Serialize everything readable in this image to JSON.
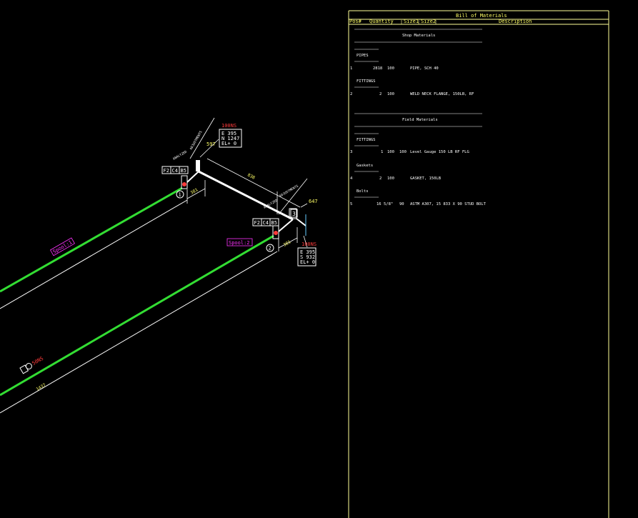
{
  "colors": {
    "background": "#000000",
    "pipe": "#33dd33",
    "line": "#ffffff",
    "frame": "#ffff99",
    "red_label": "#ff3b3b",
    "magenta_label": "#ff33ff",
    "dimension": "#ffff66"
  },
  "iso": {
    "spool1_label": "Spool:1",
    "spool2_label": "Spool:2",
    "node1": "1",
    "node2": "2",
    "node3": "3",
    "flange_tags_top": [
      "F2",
      "C4",
      "B5"
    ],
    "flange_tags_mid": [
      "F2",
      "C4",
      "B5"
    ],
    "top_100ns": "100NS",
    "mid_100ns": "100NS",
    "bottom_50ns": "50NS",
    "coord_top": [
      "E 395",
      "N 1247",
      "EL+ 0"
    ],
    "coord_mid": [
      "E 395",
      "S 932",
      "EL+ 0"
    ],
    "dim_597": "597",
    "dim_647": "647",
    "dim_838": "838",
    "dim_381a": "381",
    "dim_381b": "381",
    "dim_1437": "1437",
    "adjustments_a": "ADJUSTMENTS",
    "adjustments_b": "ADJUSTMENTS",
    "small_a": "ANALYZED",
    "small_b": "ANALYZED"
  },
  "bom": {
    "title": "Bill of Materials",
    "headers": [
      "Pos#",
      "Quantity",
      "Size1",
      "Size2",
      "Description"
    ],
    "shop_header": "Shop Materials",
    "field_header": "Field Materials",
    "groups": [
      {
        "label": "PIPES",
        "items": [
          {
            "pos": "1",
            "qty": "2818",
            "size1": "100",
            "size2": "",
            "desc": "PIPE, SCH 40"
          }
        ]
      },
      {
        "label": "FITTINGS",
        "items": [
          {
            "pos": "2",
            "qty": "2",
            "size1": "100",
            "size2": "",
            "desc": "WELD NECK FLANGE, 150LB, RF"
          }
        ]
      },
      {
        "label": "FITTINGS",
        "items": [
          {
            "pos": "3",
            "qty": "1",
            "size1": "100",
            "size2": "100",
            "desc": "Level Gauge 150 LB RF FLG"
          }
        ]
      },
      {
        "label": "Gaskets",
        "items": [
          {
            "pos": "4",
            "qty": "2",
            "size1": "100",
            "size2": "",
            "desc": "GASKET, 150LB"
          }
        ]
      },
      {
        "label": "Bolts",
        "items": [
          {
            "pos": "5",
            "qty": "16",
            "size1": "5/8\"",
            "size2": "90",
            "desc": "ASTM A307, 15 833 X 90 STUD BOLT"
          }
        ]
      }
    ]
  }
}
